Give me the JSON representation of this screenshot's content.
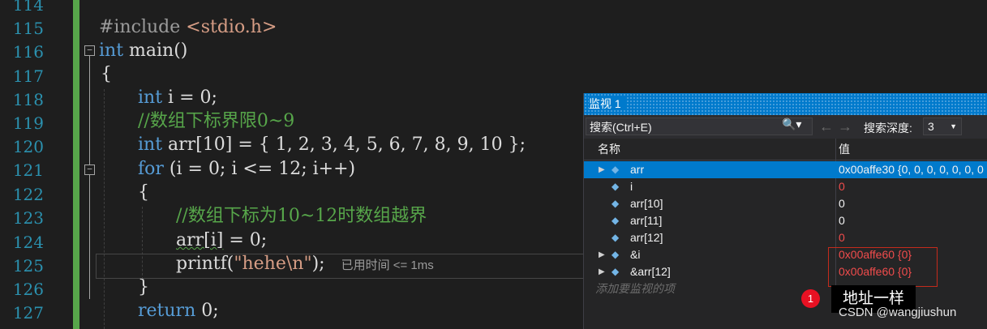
{
  "editor": {
    "line_numbers": [
      "114",
      "115",
      "116",
      "117",
      "118",
      "119",
      "120",
      "121",
      "122",
      "123",
      "124",
      "125",
      "126",
      "127"
    ],
    "lines": {
      "l115_directive": "#include ",
      "l115_header": "<stdio.h>",
      "l116_kw": "int",
      "l116_rest": " main()",
      "l117": "{",
      "l118_kw": "int",
      "l118_rest": " i = 0;",
      "l119": "//数组下标界限0~9",
      "l120_kw": "int",
      "l120_rest": " arr[10] = { 1, 2, 3, 4, 5, 6, 7, 8, 9, 10 };",
      "l121_kw": "for",
      "l121_rest": " (i = 0; i <= 12; i++)",
      "l122": "{",
      "l123": "//数组下标为10~12时数组越界",
      "l124_a": "arr[i]",
      "l124_b": " = 0;",
      "l125_fn": "printf(",
      "l125_str": "\"hehe\\n\"",
      "l125_end": ");",
      "l125_elapsed": "已用时间 <= 1ms",
      "l126": "}",
      "l127_kw": "return",
      "l127_rest": " 0;"
    },
    "colors": {
      "keyword": "#569cd6",
      "comment": "#57a64a",
      "string": "#d69d85",
      "line_number": "#2b91af"
    }
  },
  "watch": {
    "title": "监视 1",
    "search_placeholder": "搜索(Ctrl+E)",
    "nav_back": "←",
    "nav_forward": "→",
    "depth_label": "搜索深度:",
    "depth_value": "3",
    "col_name": "名称",
    "col_value": "值",
    "rows": [
      {
        "name": "arr",
        "value": "0x00affe30 {0, 0, 0, 0, 0, 0, 0",
        "expandable": true,
        "selected": true
      },
      {
        "name": "i",
        "value": "0",
        "changed": true
      },
      {
        "name": "arr[10]",
        "value": "0"
      },
      {
        "name": "arr[11]",
        "value": "0"
      },
      {
        "name": "arr[12]",
        "value": "0",
        "changed": true
      },
      {
        "name": "&i",
        "value": "0x00affe60 {0}",
        "expandable": true,
        "changed": true
      },
      {
        "name": "&arr[12]",
        "value": "0x00affe60 {0}",
        "expandable": true,
        "changed": true
      }
    ],
    "add_item": "添加要监视的项"
  },
  "annotation": {
    "badge": "1",
    "note": "地址一样"
  },
  "watermark": "CSDN @wangjiushun"
}
